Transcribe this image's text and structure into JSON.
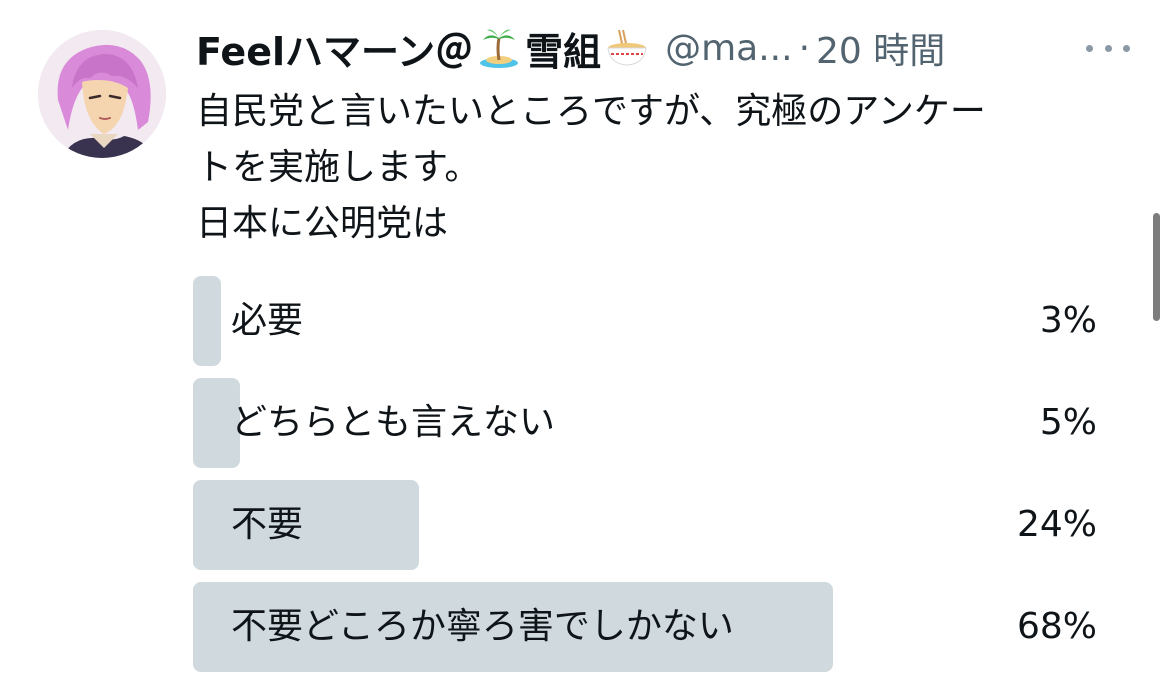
{
  "tweet": {
    "display_name": "Feelハマーン＠",
    "display_name_2": "雪組",
    "emoji_1": "palm-island-icon",
    "emoji_2": "ramen-bowl-icon",
    "handle": "@ma...",
    "separator": "·",
    "time": "20 時間",
    "more_icon": "more-horizontal-icon",
    "text_lines": [
      "自民党と言いたいところですが、究極のアンケー",
      "トを実施します。",
      "日本に公明党は"
    ]
  },
  "poll": {
    "options": [
      {
        "label": "必要",
        "percent_text": "3%",
        "percent": 3
      },
      {
        "label": "どちらとも言えない",
        "percent_text": "5%",
        "percent": 5
      },
      {
        "label": "不要",
        "percent_text": "24%",
        "percent": 24
      },
      {
        "label": "不要どころか寧ろ害でしかない",
        "percent_text": "68%",
        "percent": 68
      }
    ]
  },
  "colors": {
    "bar": "#cfd9de",
    "text": "#0f1419",
    "secondary": "#536471",
    "accent_avatar_hair": "#d98ad8"
  }
}
